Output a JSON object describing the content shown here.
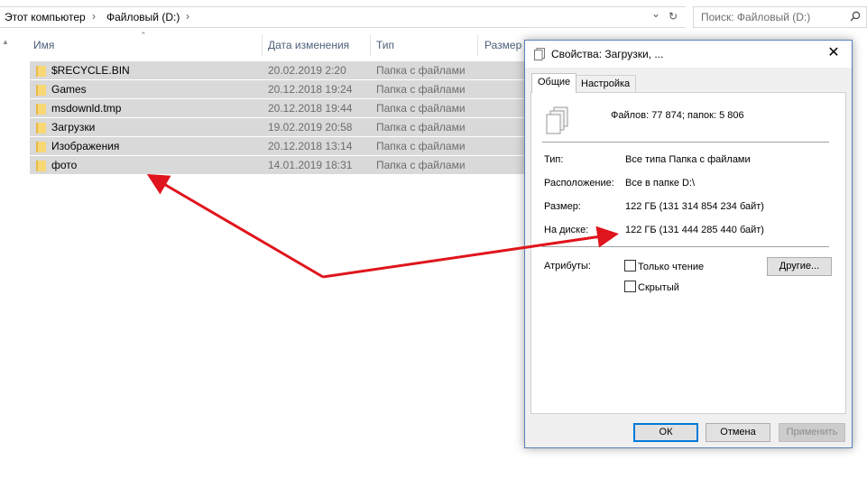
{
  "address": {
    "crumbs": [
      "Этот компьютер",
      "Файловый (D:)"
    ],
    "separator": "›",
    "dropdown": "⌄",
    "refresh": "↻"
  },
  "search": {
    "placeholder": "Поиск: Файловый (D:)"
  },
  "columns": {
    "name": "Имя",
    "date": "Дата изменения",
    "type": "Тип",
    "size": "Размер"
  },
  "files": [
    {
      "name": "$RECYCLE.BIN",
      "date": "20.02.2019 2:20",
      "type": "Папка с файлами"
    },
    {
      "name": "Games",
      "date": "20.12.2018 19:24",
      "type": "Папка с файлами"
    },
    {
      "name": "msdownld.tmp",
      "date": "20.12.2018 19:44",
      "type": "Папка с файлами"
    },
    {
      "name": "Загрузки",
      "date": "19.02.2019 20:58",
      "type": "Папка с файлами"
    },
    {
      "name": "Изображения",
      "date": "20.12.2018 13:14",
      "type": "Папка с файлами"
    },
    {
      "name": "фото",
      "date": "14.01.2019 18:31",
      "type": "Папка с файлами"
    }
  ],
  "dialog": {
    "title": "Свойства: Загрузки, ...",
    "close": "✕",
    "tabs": [
      "Общие",
      "Настройка"
    ],
    "files_count": "Файлов: 77 874; папок: 5 806",
    "props": [
      {
        "label": "Тип:",
        "value": "Все типа Папка с файлами"
      },
      {
        "label": "Расположение:",
        "value": "Все в папке D:\\"
      },
      {
        "label": "Размер:",
        "value": "122 ГБ (131 314 854 234 байт)"
      },
      {
        "label": "На диске:",
        "value": "122 ГБ (131 444 285 440 байт)"
      }
    ],
    "attributes_label": "Атрибуты:",
    "readonly_label": "Только чтение",
    "hidden_label": "Скрытый",
    "other_button": "Другие...",
    "ok_button": "ОК",
    "cancel_button": "Отмена",
    "apply_button": "Применить"
  },
  "colors": {
    "arrow": "#e0141c",
    "selection": "#d9d9d9",
    "accent": "#0078d7"
  }
}
